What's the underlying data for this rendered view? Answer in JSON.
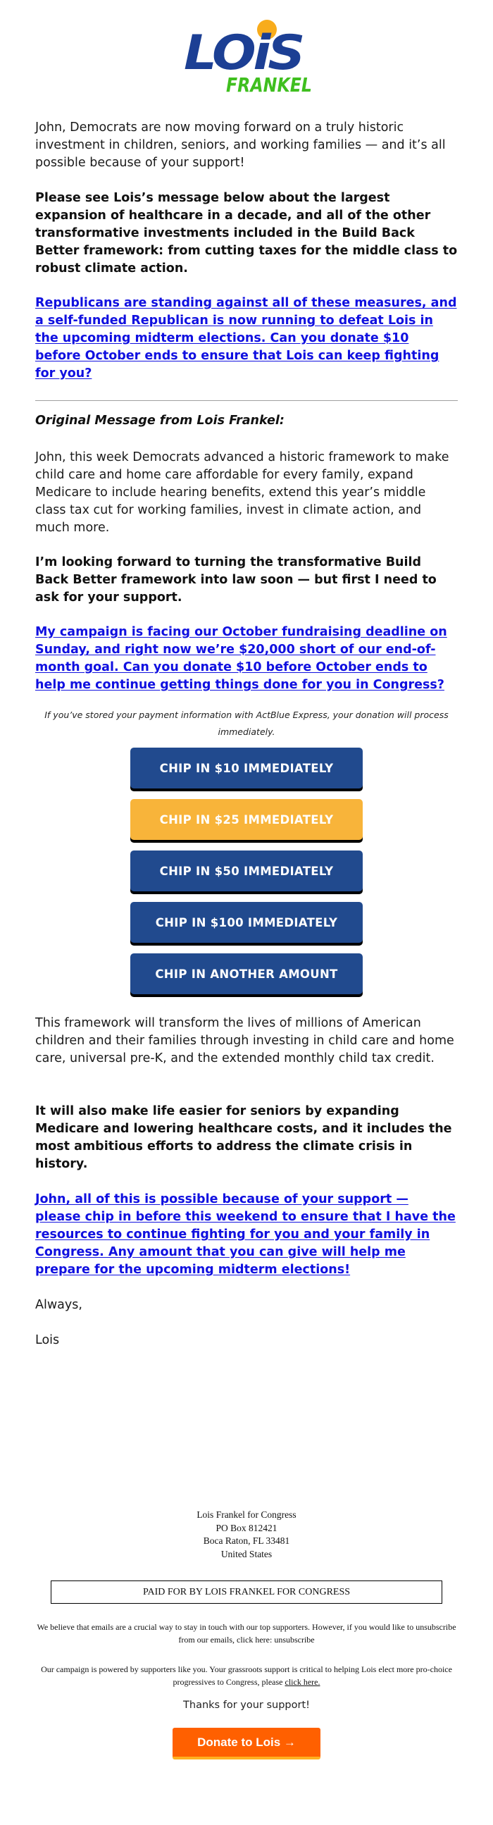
{
  "logo": {
    "first_name": "LOiS",
    "last_name": "FRANKEL",
    "colors": {
      "blue": "#1c3f94",
      "orange": "#f8ac1c",
      "green": "#3fbf1f"
    }
  },
  "intro": {
    "p1": "John, Democrats are now moving forward on a truly historic investment in children, seniors, and working families — and it’s all possible because of your support!",
    "p2": "Please see Lois’s message below about the largest expansion of healthcare in a decade, and all of the other transformative investments included in the Build Back Better framework: from cutting taxes for the middle class to robust climate action.",
    "link1": "Republicans are standing against all of these measures, and a self-funded Republican is now running to defeat Lois in the upcoming midterm elections. Can you donate $10 before October ends to ensure that Lois can keep fighting for you?"
  },
  "original": {
    "heading": "Original Message from Lois Frankel:",
    "p1": "John, this week Democrats advanced a historic framework to make child care and home care affordable for every family, expand Medicare to include hearing benefits, extend this year’s middle class tax cut for working families, invest in climate action, and much more.",
    "p2": "I’m looking forward to turning the transformative Build Back Better framework into law soon — but first I need to ask for your support.",
    "link2": "My campaign is facing our October fundraising deadline on Sunday, and right now we’re $20,000 short of our end-of-month goal. Can you donate $10 before October ends to help me continue getting things done for you in Congress?"
  },
  "actblue_note": "If you’ve stored your payment information with ActBlue Express, your donation will process immediately.",
  "buttons": [
    {
      "label": "CHIP IN $10 IMMEDIATELY",
      "color": "#214a8e"
    },
    {
      "label": "CHIP IN $25 IMMEDIATELY",
      "color": "#f8b43a"
    },
    {
      "label": "CHIP IN $50 IMMEDIATELY",
      "color": "#214a8e"
    },
    {
      "label": "CHIP IN $100 IMMEDIATELY",
      "color": "#214a8e"
    },
    {
      "label": "CHIP IN ANOTHER AMOUNT",
      "color": "#214a8e"
    }
  ],
  "closing": {
    "p1": "This framework will transform the lives of millions of American children and their families through investing in child care and home care, universal pre-K, and the extended monthly child tax credit.",
    "p2": "It will also make life easier for seniors by expanding Medicare and lowering healthcare costs, and it includes the most ambitious efforts to address the climate crisis in history.",
    "link3": "John, all of this is possible because of your support — please chip in before this weekend to ensure that I have the resources to continue fighting for you and your family in Congress. Any amount that you can give will help me prepare for the upcoming midterm elections!",
    "signoff": "Always,",
    "signature": "Lois"
  },
  "footer": {
    "address": [
      "Lois Frankel for Congress",
      "PO Box 812421",
      "Boca Raton, FL 33481",
      "United States"
    ],
    "paid_for": "PAID FOR BY LOIS FRANKEL FOR CONGRESS",
    "unsub_text": "We believe that emails are a crucial way to stay in touch with our top supporters. However, if you would like to unsubscribe from our emails, click here: ",
    "unsub_link": "unsubscribe",
    "powered_text": "Our campaign is powered by supporters like you. Your grassroots support is critical to helping Lois elect more pro-choice progressives to Congress, please ",
    "powered_link": "click here.",
    "thanks": "Thanks for your support!",
    "donate_label": "Donate to Lois →",
    "donate_color": "#ff6000"
  }
}
